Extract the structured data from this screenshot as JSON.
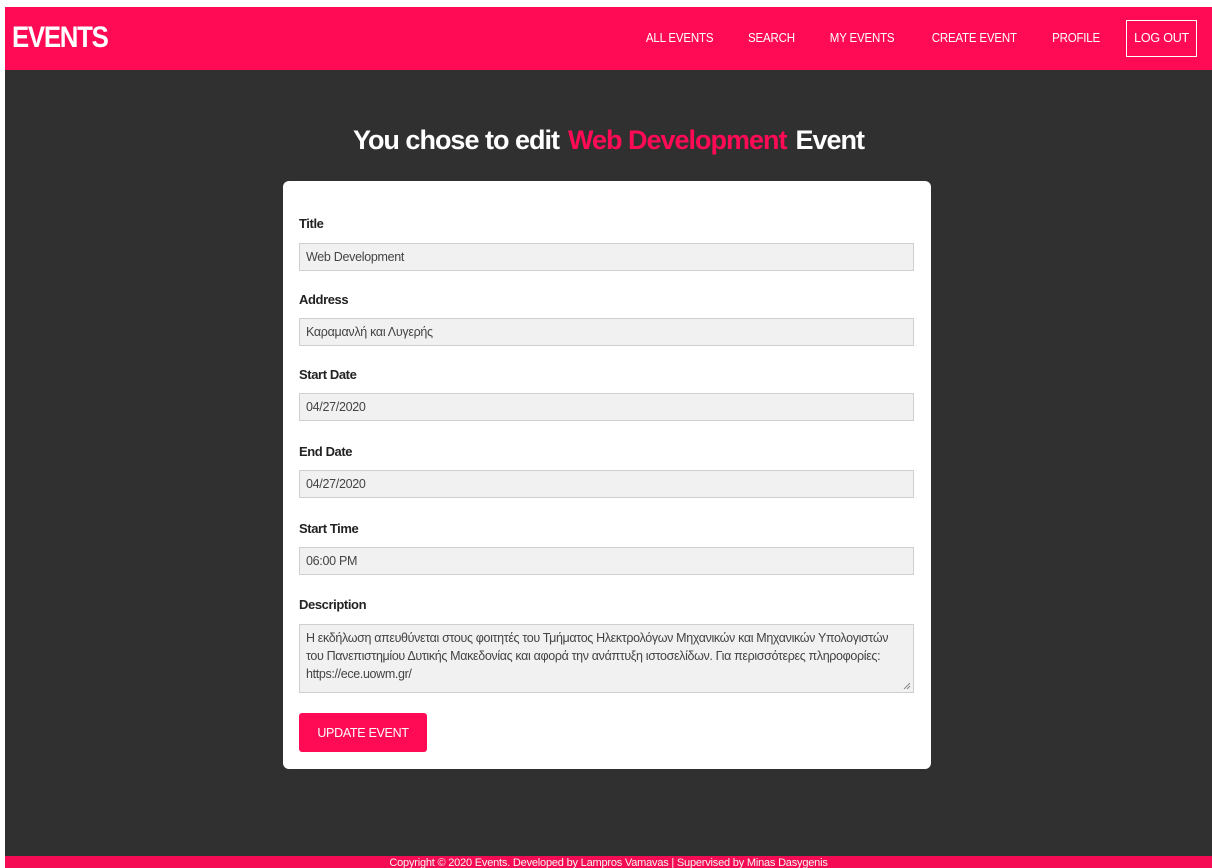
{
  "brand": "EVENTS",
  "nav": {
    "all_events": "ALL EVENTS",
    "search": "SEARCH",
    "my_events": "MY EVENTS",
    "create_event": "CREATE EVENT",
    "profile": "PROFILE",
    "logout": "LOG OUT"
  },
  "heading": {
    "prefix": "You chose to edit",
    "event_name": "Web Development",
    "suffix": "Event"
  },
  "form": {
    "title_label": "Title",
    "title_value": "Web Development",
    "address_label": "Address",
    "address_value": "Καραμανλή και Λυγερής",
    "start_date_label": "Start Date",
    "start_date_value": "04/27/2020",
    "end_date_label": "End Date",
    "end_date_value": "04/27/2020",
    "start_time_label": "Start Time",
    "start_time_value": "06:00 PM",
    "description_label": "Description",
    "description_value": "Η εκδήλωση απευθύνεται στους φοιτητές του Τμήματος Ηλεκτρολόγων Μηχανικών και Μηχανικών Υπολογιστών του Πανεπιστημίου Δυτικής Μακεδονίας και αφορά την ανάπτυξη ιστοσελίδων. Για περισσότερες πληροφορίες: https://ece.uowm.gr/",
    "submit_label": "UPDATE EVENT"
  },
  "footer": {
    "text": "Copyright © 2020 Events. Developed by Lampros Vamavas | Supervised by Minas Dasygenis"
  },
  "colors": {
    "accent": "#ff0a55",
    "background": "#303030",
    "card": "#ffffff"
  }
}
